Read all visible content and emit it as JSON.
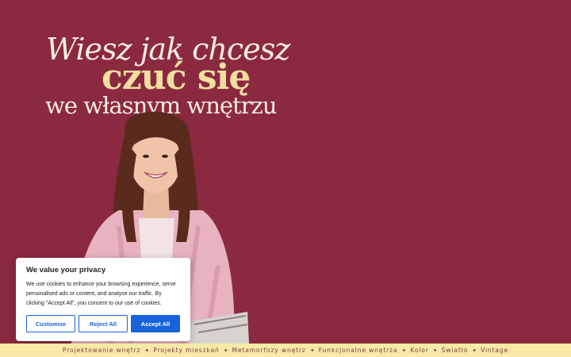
{
  "hero": {
    "headline": {
      "line1": "Wiesz jak chcesz",
      "line2": "czuć się",
      "line3": "we własnym wnętrzu"
    }
  },
  "cookie_banner": {
    "title": "We value your privacy",
    "body": "We use cookies to enhance your browsing experience, serve personalised ads or content, and analyse our traffic. By clicking \"Accept All\", you consent to our use of cookies.",
    "customise_label": "Customise",
    "reject_label": "Reject All",
    "accept_label": "Accept All"
  },
  "marquee": {
    "items": [
      "Projektowanie wnętrz",
      "Projekty mieszkań",
      "Metamorfozy wnętrz",
      "Funkcjonalne wnętrza",
      "Kolor",
      "Światło",
      "Vintage"
    ],
    "separator": "✦"
  },
  "colors": {
    "background": "#8b2940",
    "headline_accent": "#f3dfa0",
    "marquee_bg": "#f6eaa6",
    "cookie_button": "#1863dc"
  }
}
